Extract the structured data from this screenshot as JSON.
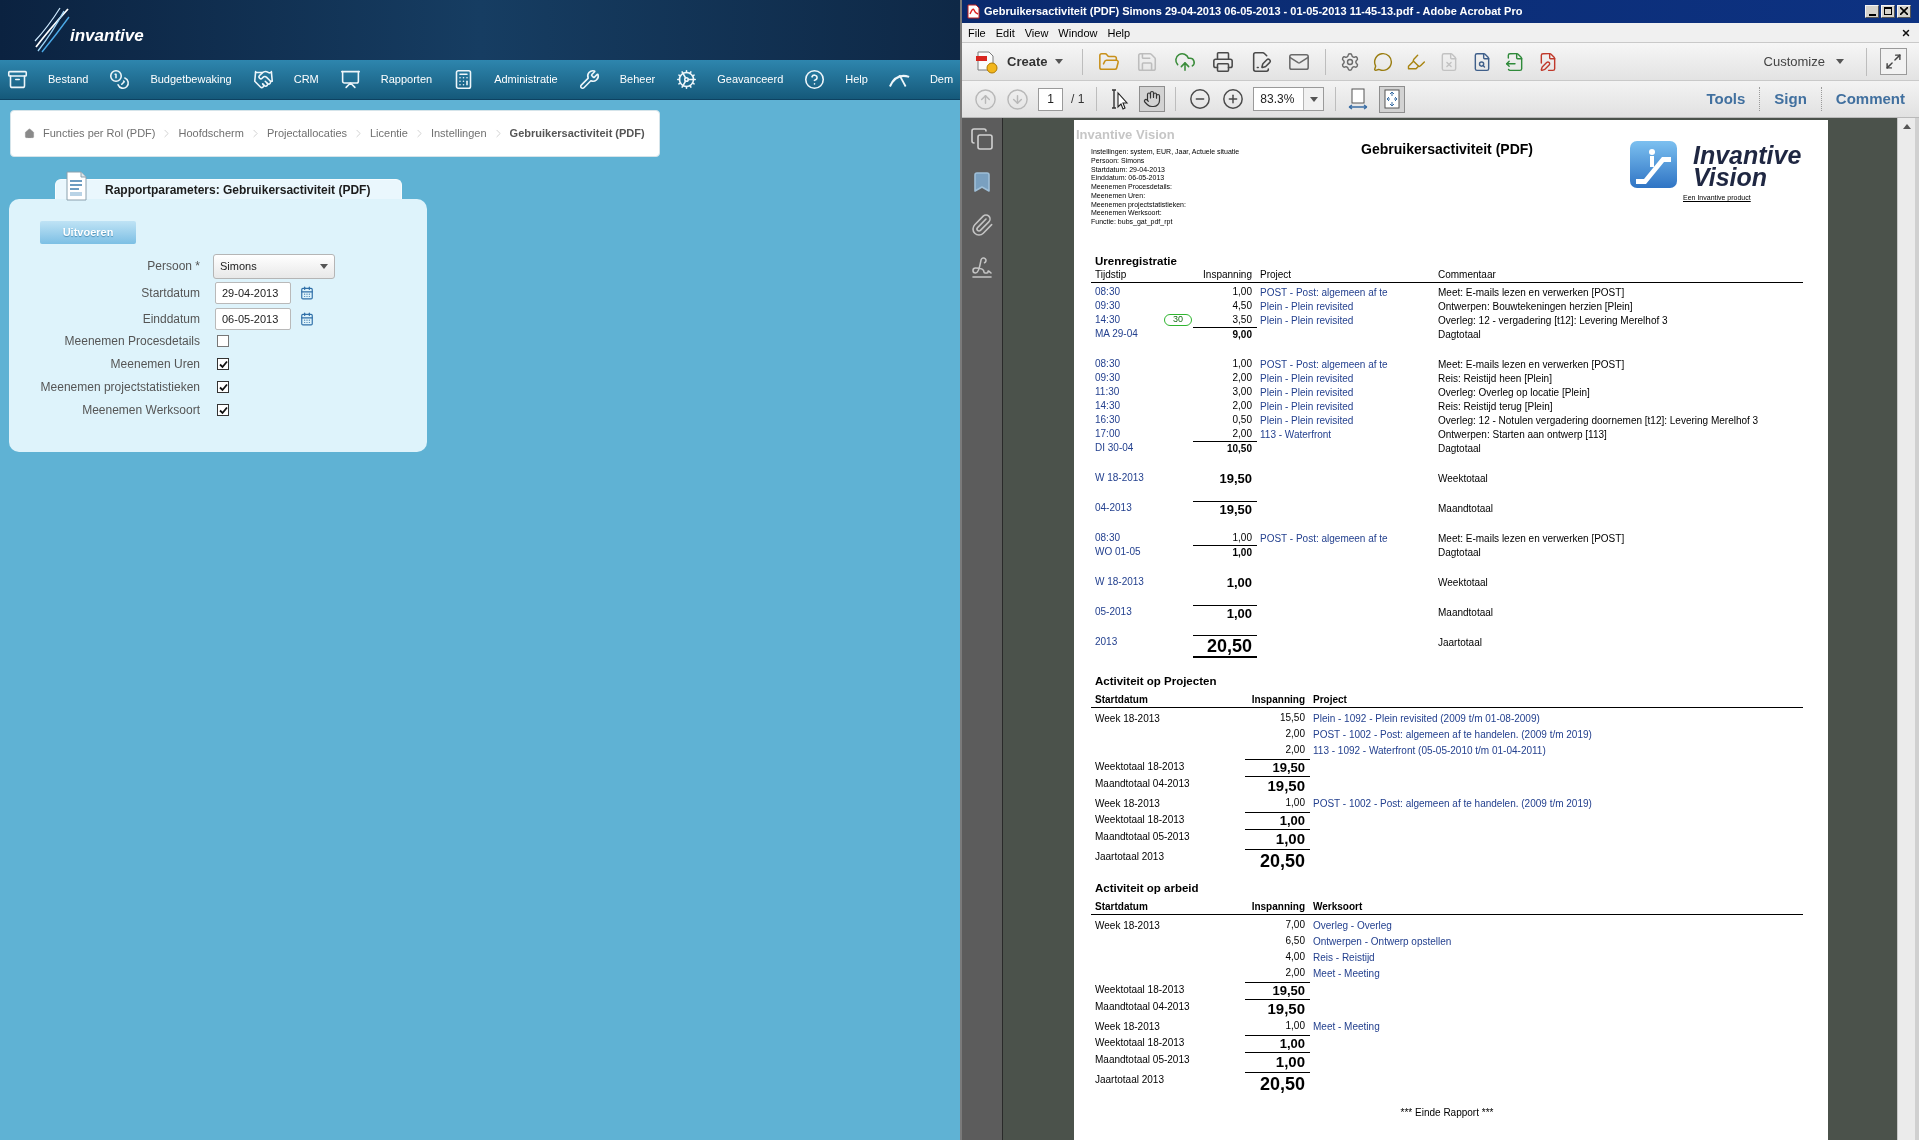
{
  "portal": {
    "logo": "invantive",
    "nav": [
      {
        "label": "Bestand"
      },
      {
        "label": "Budgetbewaking"
      },
      {
        "label": "CRM"
      },
      {
        "label": "Rapporten"
      },
      {
        "label": "Administratie"
      },
      {
        "label": "Beheer"
      },
      {
        "label": "Geavanceerd"
      },
      {
        "label": "Help"
      },
      {
        "label": "Dem"
      }
    ],
    "breadcrumb": [
      {
        "label": "Functies per Rol (PDF)",
        "current": false
      },
      {
        "label": "Hoofdscherm",
        "current": false
      },
      {
        "label": "Projectallocaties",
        "current": false
      },
      {
        "label": "Licentie",
        "current": false
      },
      {
        "label": "Instellingen",
        "current": false
      },
      {
        "label": "Gebruikersactiviteit (PDF)",
        "current": true
      }
    ],
    "panel": {
      "title": "Rapportparameters: Gebruikersactiviteit (PDF)",
      "run_button": "Uitvoeren",
      "fields": [
        {
          "kind": "select",
          "label": "Persoon *",
          "value": "Simons"
        },
        {
          "kind": "date",
          "label": "Startdatum",
          "value": "29-04-2013"
        },
        {
          "kind": "date",
          "label": "Einddatum",
          "value": "06-05-2013"
        },
        {
          "kind": "checkbox",
          "label": "Meenemen Procesdetails",
          "checked": false
        },
        {
          "kind": "checkbox",
          "label": "Meenemen Uren",
          "checked": true
        },
        {
          "kind": "checkbox",
          "label": "Meenemen projectstatistieken",
          "checked": true
        },
        {
          "kind": "checkbox",
          "label": "Meenemen Werksoort",
          "checked": true
        }
      ]
    }
  },
  "acrobat": {
    "title": "Gebruikersactiviteit (PDF) Simons 29-04-2013 06-05-2013 - 01-05-2013 11-45-13.pdf - Adobe Acrobat Pro",
    "menu": [
      "File",
      "Edit",
      "View",
      "Window",
      "Help"
    ],
    "create": "Create",
    "file_tools": [
      {
        "disabled": false
      },
      {
        "disabled": true
      },
      {
        "disabled": false
      },
      {
        "disabled": false
      },
      {
        "disabled": false
      },
      {
        "disabled": false
      }
    ],
    "doc_tools": [
      {
        "disabled": false
      },
      {
        "disabled": false
      },
      {
        "disabled": false
      },
      {
        "disabled": true
      },
      {
        "disabled": false
      },
      {
        "disabled": false
      },
      {
        "disabled": false
      }
    ],
    "customize": "Customize",
    "page_buttons": [
      {
        "disabled": true
      },
      {
        "disabled": true
      }
    ],
    "page": "1",
    "page_total": "/ 1",
    "modes": [
      {
        "selected": false
      },
      {
        "selected": true
      }
    ],
    "zoom": "83.3%",
    "views": [
      {
        "selected": false
      },
      {
        "selected": true
      }
    ],
    "panes": [
      "Tools",
      "Sign",
      "Comment"
    ]
  },
  "document": {
    "brand": "Invantive Vision",
    "parameters": [
      "Instellingen: system, EUR, Jaar, Actuele situatie",
      "Persoon: Simons",
      "Startdatum: 29-04-2013",
      "Einddatum: 06-05-2013",
      "Meenemen Procesdetails:",
      "Meenemen Uren:",
      "Meenemen projectstatistieken:",
      "Meenemen Werksoort:",
      "Functie: bubs_gat_pdf_rpt"
    ],
    "title": "Gebruikersactiviteit (PDF)",
    "logo": "Invantive Vision",
    "tagline": "Een Invantive product",
    "sections": [
      {
        "kind": "detail",
        "title": "Urenregistratie",
        "columns": [
          "Tijdstip",
          "Inspanning",
          "Project",
          "Commentaar"
        ],
        "rows": [
          {
            "kind": "entry",
            "period": "08:30",
            "effort": "1,00",
            "project": "POST - Post: algemeen af te",
            "comment": "Meet: E-mails lezen en verwerken [POST]"
          },
          {
            "kind": "entry",
            "period": "09:30",
            "effort": "4,50",
            "project": "Plein - Plein revisited",
            "comment": "Ontwerpen: Bouwtekeningen herzien [Plein]"
          },
          {
            "kind": "entry",
            "period": "14:30",
            "badge": "30",
            "effort": "3,50",
            "project": "Plein - Plein revisited",
            "comment": "Overleg: 12 - vergadering [t12]: Levering Merelhof 3"
          },
          {
            "kind": "day_total",
            "period": "MA 29-04",
            "effort": "9,00",
            "comment": "Dagtotaal"
          },
          {
            "kind": "entry",
            "period": "08:30",
            "effort": "1,00",
            "project": "POST - Post: algemeen af te",
            "comment": "Meet: E-mails lezen en verwerken [POST]"
          },
          {
            "kind": "entry",
            "period": "09:30",
            "effort": "2,00",
            "project": "Plein - Plein revisited",
            "comment": "Reis: Reistijd heen [Plein]"
          },
          {
            "kind": "entry",
            "period": "11:30",
            "effort": "3,00",
            "project": "Plein - Plein revisited",
            "comment": "Overleg: Overleg op locatie [Plein]"
          },
          {
            "kind": "entry",
            "period": "14:30",
            "effort": "2,00",
            "project": "Plein - Plein revisited",
            "comment": "Reis: Reistijd terug [Plein]"
          },
          {
            "kind": "entry",
            "period": "16:30",
            "effort": "0,50",
            "project": "Plein - Plein revisited",
            "comment": "Overleg: 12 - Notulen vergadering doornemen [t12]: Levering Merelhof 3"
          },
          {
            "kind": "entry",
            "period": "17:00",
            "effort": "2,00",
            "project": "113 - Waterfront",
            "comment": "Ontwerpen: Starten aan ontwerp [113]"
          },
          {
            "kind": "day_total",
            "period": "DI 30-04",
            "effort": "10,50",
            "comment": "Dagtotaal"
          },
          {
            "kind": "week_total",
            "period": "W 18-2013",
            "effort": "19,50",
            "comment": "Weektotaal"
          },
          {
            "kind": "month_total",
            "period": "04-2013",
            "effort": "19,50",
            "comment": "Maandtotaal"
          },
          {
            "kind": "entry",
            "period": "08:30",
            "effort": "1,00",
            "project": "POST - Post: algemeen af te",
            "comment": "Meet: E-mails lezen en verwerken [POST]"
          },
          {
            "kind": "day_total",
            "period": "WO 01-05",
            "effort": "1,00",
            "comment": "Dagtotaal"
          },
          {
            "kind": "week_total",
            "period": "W 18-2013",
            "effort": "1,00",
            "comment": "Weektotaal"
          },
          {
            "kind": "month_total",
            "period": "05-2013",
            "effort": "1,00",
            "comment": "Maandtotaal"
          },
          {
            "kind": "year_total",
            "period": "2013",
            "effort": "20,50",
            "comment": "Jaartotaal"
          }
        ]
      },
      {
        "kind": "summary",
        "title": "Activiteit op Projecten",
        "columns": [
          "Startdatum",
          "Inspanning",
          "Project"
        ],
        "rows": [
          {
            "kind": "entry",
            "period": "Week 18-2013",
            "effort": "15,50",
            "project": "Plein - 1092 - Plein revisited (2009 t/m 01-08-2009)"
          },
          {
            "kind": "entry",
            "effort": "2,00",
            "project": "POST - 1002 - Post: algemeen af te handelen. (2009 t/m 2019)"
          },
          {
            "kind": "entry",
            "effort": "2,00",
            "project": "113 - 1092 - Waterfront (05-05-2010 t/m 01-04-2011)"
          },
          {
            "kind": "week_total",
            "period": "Weektotaal 18-2013",
            "effort": "19,50"
          },
          {
            "kind": "month_total",
            "period": "Maandtotaal 04-2013",
            "effort": "19,50"
          },
          {
            "kind": "entry",
            "period": "Week 18-2013",
            "effort": "1,00",
            "project": "POST - 1002 - Post: algemeen af te handelen. (2009 t/m 2019)"
          },
          {
            "kind": "week_total",
            "period": "Weektotaal 18-2013",
            "effort": "1,00"
          },
          {
            "kind": "month_total",
            "period": "Maandtotaal 05-2013",
            "effort": "1,00"
          },
          {
            "kind": "year_total",
            "period": "Jaartotaal 2013",
            "effort": "20,50"
          }
        ]
      },
      {
        "kind": "summary",
        "title": "Activiteit op arbeid",
        "columns": [
          "Startdatum",
          "Inspanning",
          "Werksoort"
        ],
        "rows": [
          {
            "kind": "entry",
            "period": "Week 18-2013",
            "effort": "7,00",
            "work_type": "Overleg - Overleg"
          },
          {
            "kind": "entry",
            "effort": "6,50",
            "work_type": "Ontwerpen - Ontwerp opstellen"
          },
          {
            "kind": "entry",
            "effort": "4,00",
            "work_type": "Reis - Reistijd"
          },
          {
            "kind": "entry",
            "effort": "2,00",
            "work_type": "Meet - Meeting"
          },
          {
            "kind": "week_total",
            "period": "Weektotaal 18-2013",
            "effort": "19,50"
          },
          {
            "kind": "month_total",
            "period": "Maandtotaal 04-2013",
            "effort": "19,50"
          },
          {
            "kind": "entry",
            "period": "Week 18-2013",
            "effort": "1,00",
            "work_type": "Meet - Meeting"
          },
          {
            "kind": "week_total",
            "period": "Weektotaal 18-2013",
            "effort": "1,00"
          },
          {
            "kind": "month_total",
            "period": "Maandtotaal 05-2013",
            "effort": "1,00"
          },
          {
            "kind": "year_total",
            "period": "Jaartotaal 2013",
            "effort": "20,50"
          }
        ]
      }
    ],
    "footer": "*** Einde Rapport ***"
  }
}
